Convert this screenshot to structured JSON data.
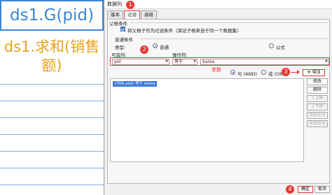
{
  "sheet": {
    "cell_a": "ds1.G(pid)",
    "cell_b": "ds1.求和(销售额)"
  },
  "dialog": {
    "title": "数据列",
    "tabs": [
      {
        "label": "基本",
        "active": false
      },
      {
        "label": "过滤",
        "active": true
      },
      {
        "label": "高级",
        "active": false
      }
    ],
    "parent_section": "父格条件",
    "parent_check_label": "将父格子作为过滤条件（保证子格来自于同一个数据集）",
    "normal_section": "普通条件",
    "type_label": "类型:",
    "radio_normal": "普通",
    "radio_formula": "公式",
    "column_label": "可选列:",
    "operator_label": "操作符:",
    "column_value": "pid",
    "operator_value": "等于",
    "value_value": "$area",
    "param_label": "参数",
    "radio_and": "与 (AND)",
    "radio_or": "或 (OR)",
    "add_button": "增加",
    "modify_button": "修改",
    "delete_button": "删除",
    "up_button": "上移",
    "down_button": "下移",
    "add_bracket_button": "添加括号",
    "remove_bracket_button": "去掉括号",
    "condition_item": "{列名:pid} 等于 $area",
    "ok_button": "确定",
    "cancel_button": "取消"
  },
  "annotations": [
    "1",
    "2",
    "3",
    "4"
  ],
  "colors": {
    "accent_red": "#e53935",
    "cell_blue": "#3a86d4",
    "cell_orange": "#e8a21a",
    "selection_blue": "#3b78d8"
  }
}
